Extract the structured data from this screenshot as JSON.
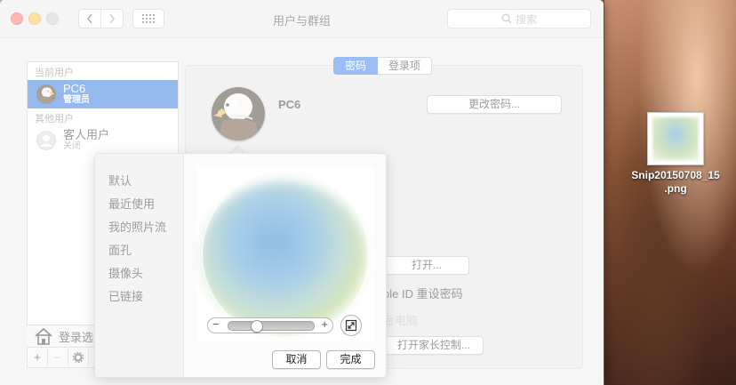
{
  "window": {
    "title": "用户与群组",
    "search_placeholder": "搜索"
  },
  "sidebar": {
    "current_users_header": "当前用户",
    "other_users_header": "其他用户",
    "users": [
      {
        "name": "PC6",
        "role": "管理员",
        "selected": true
      },
      {
        "name": "客人用户",
        "role": "关闭",
        "selected": false
      }
    ],
    "login_options_label": "登录选",
    "toolbar": {
      "add": "+",
      "remove": "−"
    }
  },
  "main": {
    "tabs": [
      {
        "label": "密码",
        "active": true
      },
      {
        "label": "登录项",
        "active": false
      }
    ],
    "user_name": "PC6",
    "change_password_button": "更改密码...",
    "open_button": "打开...",
    "apple_id_reset_text": "ple ID 重设密码",
    "computer_text": "台电脑",
    "parental_controls_button": "打开家长控制..."
  },
  "popover": {
    "categories": [
      "默认",
      "最近使用",
      "我的照片流",
      "面孔",
      "摄像头",
      "已链接"
    ],
    "zoom": {
      "minus": "−",
      "plus": "+",
      "value": 0.3
    },
    "cancel_button": "取消",
    "done_button": "完成"
  },
  "desktop": {
    "file_name_line1": "Snip20150708_15",
    "file_name_line2": ".png"
  },
  "colors": {
    "accent": "#1662d8",
    "close": "#fc5f57",
    "minimize": "#fdbc2e"
  }
}
